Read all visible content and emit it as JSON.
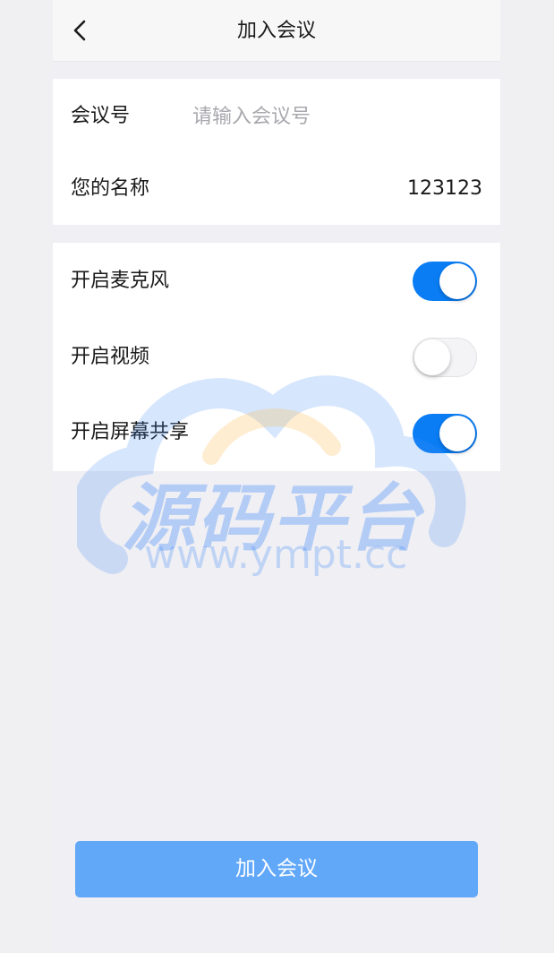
{
  "nav": {
    "title": "加入会议"
  },
  "form": {
    "meeting_id": {
      "label": "会议号",
      "value": "",
      "placeholder": "请输入会议号"
    },
    "name": {
      "label": "您的名称",
      "value": "123123"
    }
  },
  "settings": [
    {
      "label": "开启麦克风",
      "enabled": true
    },
    {
      "label": "开启视频",
      "enabled": false
    },
    {
      "label": "开启屏幕共享",
      "enabled": true
    }
  ],
  "watermark": {
    "title": "源码平台",
    "url": "www.ympt.cc"
  },
  "join_button": {
    "label": "加入会议"
  },
  "colors": {
    "accent": "#0a7df5",
    "button": "#62a8f9",
    "background": "#efeff4"
  },
  "icons": {
    "back": "chevron-left-icon"
  }
}
